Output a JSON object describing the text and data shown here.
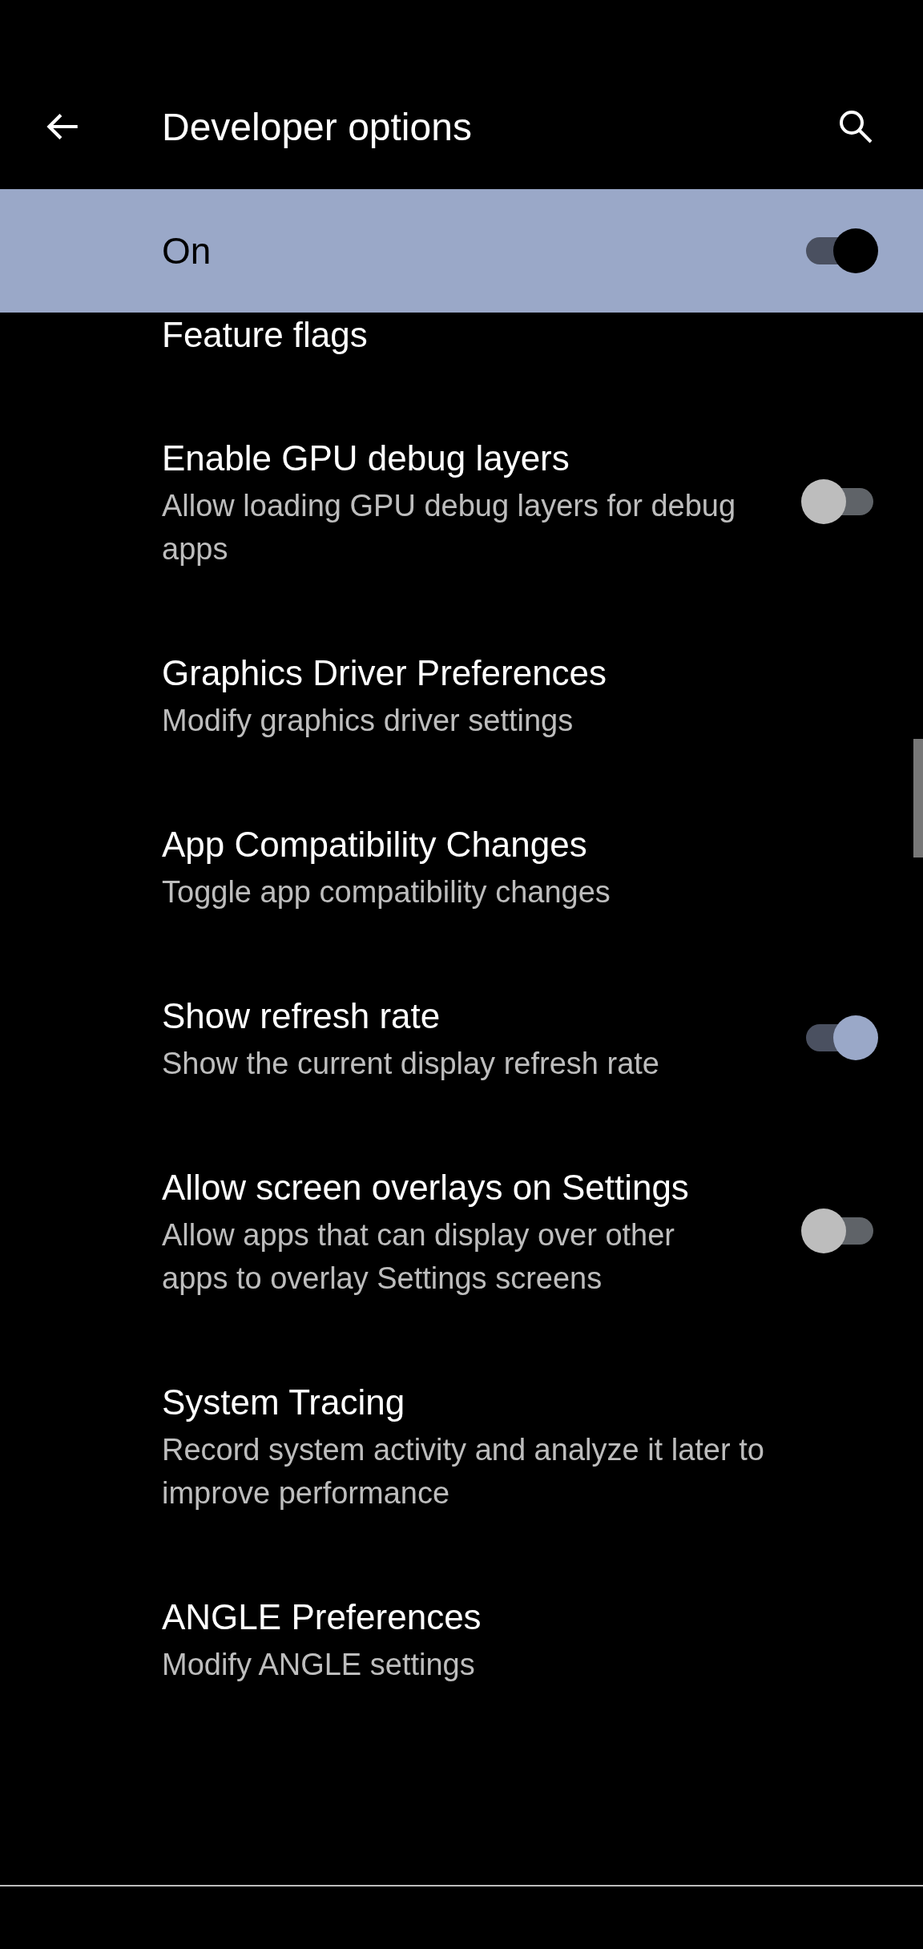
{
  "app_bar": {
    "title": "Developer options"
  },
  "master_switch": {
    "label": "On",
    "on": true
  },
  "settings": [
    {
      "kind": "link",
      "title": "Feature flags"
    },
    {
      "kind": "toggle",
      "title": "Enable GPU debug layers",
      "summary": "Allow loading GPU debug layers for debug apps",
      "on": false
    },
    {
      "kind": "link",
      "title": "Graphics Driver Preferences",
      "summary": "Modify graphics driver settings"
    },
    {
      "kind": "link",
      "title": "App Compatibility Changes",
      "summary": "Toggle app compatibility changes"
    },
    {
      "kind": "toggle",
      "title": "Show refresh rate",
      "summary": "Show the current display refresh rate",
      "on": true
    },
    {
      "kind": "toggle",
      "title": "Allow screen overlays on Settings",
      "summary": "Allow apps that can display over other apps to overlay Settings screens",
      "on": false
    },
    {
      "kind": "link",
      "title": "System Tracing",
      "summary": "Record system activity and analyze it later to improve performance"
    },
    {
      "kind": "link",
      "title": "ANGLE Preferences",
      "summary": "Modify ANGLE settings"
    }
  ]
}
